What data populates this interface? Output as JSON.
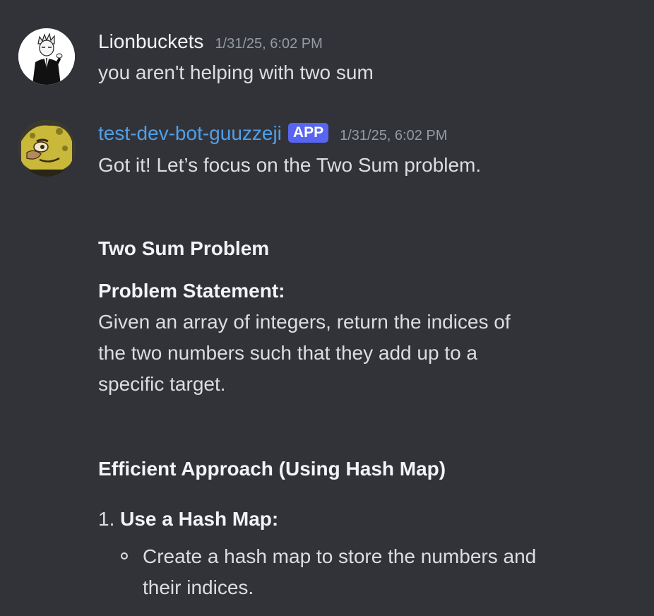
{
  "messages": [
    {
      "username": "Lionbuckets",
      "timestamp": "1/31/25, 6:02 PM",
      "text": "you aren't helping with two sum",
      "avatar_icon": "anime-character-avatar"
    },
    {
      "username": "test-dev-bot-guuzzeji",
      "badge": "APP",
      "timestamp": "1/31/25, 6:02 PM",
      "text": "Got it! Let’s focus on the Two Sum problem.",
      "avatar_icon": "spongebob-avatar",
      "content": {
        "heading": "Two Sum Problem",
        "statement_label": "Problem Statement:",
        "statement_lines": [
          "Given an array of integers, return the indices of",
          "the two numbers such that they add up to a",
          "specific target."
        ],
        "approach_heading": "Efficient Approach (Using Hash Map)",
        "list": [
          {
            "number": "1.",
            "title": "Use a Hash Map:",
            "bullets": [
              {
                "lines": [
                  "Create a hash map to store the numbers and",
                  "their indices."
                ]
              }
            ]
          }
        ]
      }
    }
  ],
  "colors": {
    "background": "#323339",
    "text": "#dbdee1",
    "username": "#f2f3f5",
    "bot_username": "#4f9fe8",
    "badge": "#5865f2",
    "timestamp": "#949ba4"
  }
}
